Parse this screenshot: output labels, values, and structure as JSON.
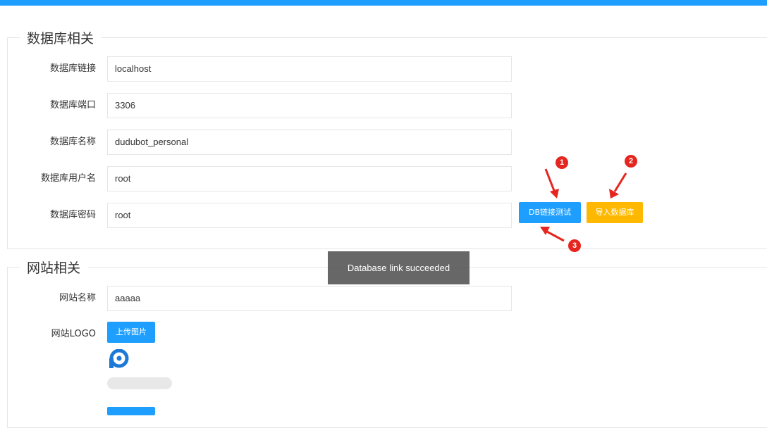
{
  "database_section": {
    "legend": "数据库相关",
    "fields": [
      {
        "label": "数据库链接",
        "value": "localhost"
      },
      {
        "label": "数据库端口",
        "value": "3306"
      },
      {
        "label": "数据库名称",
        "value": "dudubot_personal"
      },
      {
        "label": "数据库用户名",
        "value": "root"
      },
      {
        "label": "数据库密码",
        "value": "root"
      }
    ],
    "test_button": "DB链接测试",
    "import_button": "导入数据库"
  },
  "site_section": {
    "legend": "网站相关",
    "name_label": "网站名称",
    "name_value": "aaaaa",
    "logo_label": "网站LOGO",
    "upload_button": "上传图片",
    "upload_progress": 0
  },
  "toast": {
    "message": "Database link succeeded"
  },
  "annotations": [
    "1",
    "2",
    "3"
  ],
  "colors": {
    "accent": "#1e9fff",
    "warm": "#ffb800",
    "annotation": "#e5261f"
  }
}
